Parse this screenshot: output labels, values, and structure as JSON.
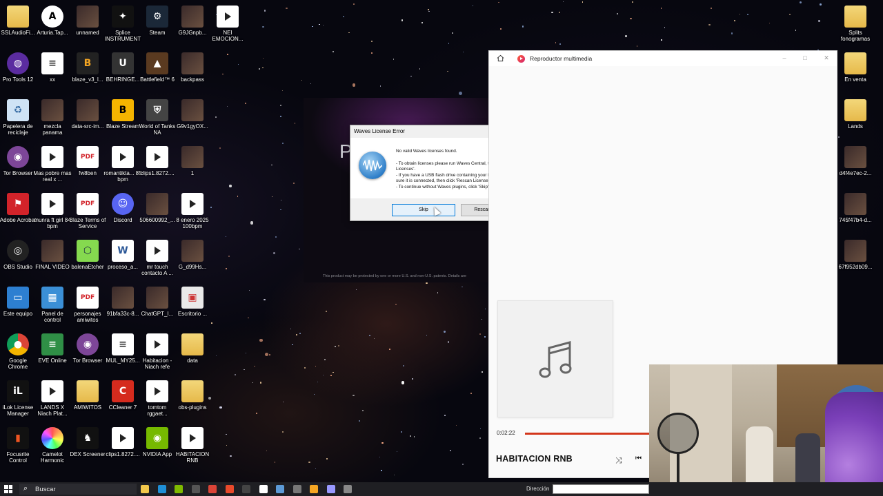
{
  "desktop": {
    "icons": [
      {
        "label": "SSLAudioFi...",
        "kind": "folder"
      },
      {
        "label": "Arturia.Tap...",
        "kind": "arturia"
      },
      {
        "label": "unnamed",
        "kind": "image"
      },
      {
        "label": "Splice INSTRUMENT",
        "kind": "splice"
      },
      {
        "label": "Steam",
        "kind": "steam"
      },
      {
        "label": "G9JGnpb...",
        "kind": "image"
      },
      {
        "label": "NEI EMOCION...",
        "kind": "video"
      },
      {
        "label": "Pro Tools 12",
        "kind": "protools"
      },
      {
        "label": "xx",
        "kind": "file"
      },
      {
        "label": "blaze_v3_l...",
        "kind": "blaze"
      },
      {
        "label": "BEHRINGE...",
        "kind": "behringer"
      },
      {
        "label": "Battlefield™ 6",
        "kind": "game"
      },
      {
        "label": "backpass",
        "kind": "image"
      },
      {
        "label": "Papelera de reciclaje",
        "kind": "recycle"
      },
      {
        "label": "mezcla panama",
        "kind": "image"
      },
      {
        "label": "data-src-im...",
        "kind": "image"
      },
      {
        "label": "Blaze Stream",
        "kind": "blazestream"
      },
      {
        "label": "World of Tanks NA",
        "kind": "tanks"
      },
      {
        "label": "G9v1gyOX...",
        "kind": "image"
      },
      {
        "label": "Tor Browser",
        "kind": "tor"
      },
      {
        "label": "Mas pobre mas real x ...",
        "kind": "video"
      },
      {
        "label": "fw8ben",
        "kind": "pdf"
      },
      {
        "label": "romantikta... 85 bpm",
        "kind": "video"
      },
      {
        "label": "clips1.8272....",
        "kind": "video"
      },
      {
        "label": "1",
        "kind": "image"
      },
      {
        "label": "Adobe Acrobat",
        "kind": "acrobat"
      },
      {
        "label": "munra ft girl 84 bpm",
        "kind": "video"
      },
      {
        "label": "Blaze Terms of Service",
        "kind": "pdf"
      },
      {
        "label": "Discord",
        "kind": "discord"
      },
      {
        "label": "506600992_...",
        "kind": "image"
      },
      {
        "label": "8 enero 2025 100bpm",
        "kind": "video"
      },
      {
        "label": "OBS Studio",
        "kind": "obs"
      },
      {
        "label": "FINAL VIDEO",
        "kind": "image"
      },
      {
        "label": "balenaEtcher",
        "kind": "balena"
      },
      {
        "label": "proceso_a...",
        "kind": "word"
      },
      {
        "label": "mr touch contacto A ...",
        "kind": "video"
      },
      {
        "label": "G_d99Hs...",
        "kind": "image"
      },
      {
        "label": "Este equipo",
        "kind": "pc"
      },
      {
        "label": "Panel de control",
        "kind": "control"
      },
      {
        "label": "personajes amiwitos",
        "kind": "pdf"
      },
      {
        "label": "91bfa33c-8...",
        "kind": "image"
      },
      {
        "label": "ChatGPT_I...",
        "kind": "image"
      },
      {
        "label": "Escritorio ...",
        "kind": "remote"
      },
      {
        "label": "Google Chrome",
        "kind": "chrome"
      },
      {
        "label": "EVE Online",
        "kind": "eve"
      },
      {
        "label": "Tor Browser",
        "kind": "tor"
      },
      {
        "label": "MUL_MY25...",
        "kind": "file"
      },
      {
        "label": "Habitacion - Niach refe",
        "kind": "video"
      },
      {
        "label": "data",
        "kind": "folder"
      },
      {
        "label": "iLok License Manager",
        "kind": "ilok"
      },
      {
        "label": "LANDS X Niach Plat...",
        "kind": "video"
      },
      {
        "label": "AMIWITOS",
        "kind": "folder"
      },
      {
        "label": "CCleaner 7",
        "kind": "ccleaner"
      },
      {
        "label": "tomtom rggaet...",
        "kind": "video"
      },
      {
        "label": "obs-plugins",
        "kind": "folder"
      },
      {
        "label": "Focusrite Control",
        "kind": "focusrite"
      },
      {
        "label": "Camelot Harmonic",
        "kind": "camelot"
      },
      {
        "label": "DEX Screener",
        "kind": "dex"
      },
      {
        "label": "clips1.8272....",
        "kind": "video"
      },
      {
        "label": "NVIDIA App",
        "kind": "nvidia"
      },
      {
        "label": "HABITACION RNB",
        "kind": "video"
      }
    ],
    "right_icons": [
      {
        "label": "Splits fonogramas",
        "kind": "folder"
      },
      {
        "label": "En venta",
        "kind": "folder"
      },
      {
        "label": "Lands",
        "kind": "folder"
      },
      {
        "label": "d4f4e7ec-2...",
        "kind": "image"
      },
      {
        "label": "745f47b4-d...",
        "kind": "image"
      },
      {
        "label": "67f952db09...",
        "kind": "image"
      }
    ]
  },
  "waves_splash": {
    "letter": "P",
    "footer": "This product may be protected by one or more U.S. and non-U.S. patents.  Details are"
  },
  "waves_dialog": {
    "title": "Waves License Error",
    "message_heading": "No valid Waves licenses found.",
    "message_lines": [
      "- To obtain licenses please run Waves Central, then click 'Rescan Licenses'.",
      "- If you have a USB flash drive containing your license(s), make sure it is connected, then click 'Rescan Licenses'.",
      "- To continue without Waves plugins, click 'Skip'."
    ],
    "skip_label": "Skip",
    "rescan_label": "Rescan Licenses"
  },
  "media_player": {
    "title": "Reproductor multimedia",
    "elapsed": "0:02:22",
    "progress": 0.4,
    "track_title": "HABITACION RNB",
    "accent": "#d3361b"
  },
  "taskbar": {
    "search_label": "Buscar",
    "address_label": "Dirección",
    "pinned_icons": [
      "file-explorer-icon",
      "edge-icon",
      "xbox-icon",
      "notepad-icon",
      "chrome-icon",
      "media-player-icon",
      "obs-icon",
      "capcut-icon",
      "image-icon",
      "arturia-icon",
      "blaze-icon",
      "premiere-icon",
      "snip-icon"
    ]
  }
}
